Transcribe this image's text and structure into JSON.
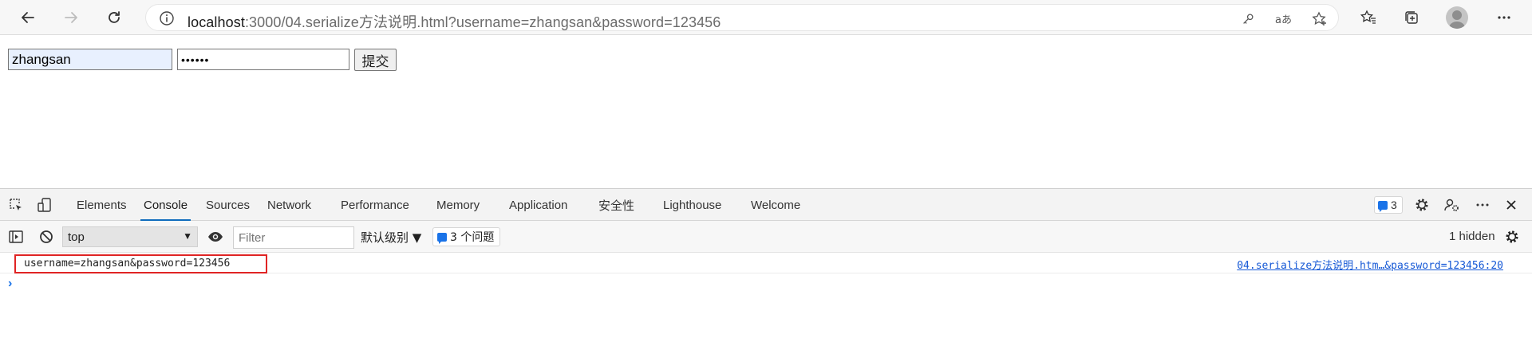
{
  "browser": {
    "url_host": "localhost",
    "url_rest": ":3000/04.serialize方法说明.html?username=zhangsan&password=123456"
  },
  "page": {
    "username_value": "zhangsan",
    "password_value": "••••••",
    "submit_label": "提交"
  },
  "devtools": {
    "tabs": [
      {
        "label": "Elements"
      },
      {
        "label": "Console"
      },
      {
        "label": "Sources"
      },
      {
        "label": "Network"
      },
      {
        "label": "Performance"
      },
      {
        "label": "Memory"
      },
      {
        "label": "Application"
      },
      {
        "label": "安全性"
      },
      {
        "label": "Lighthouse"
      },
      {
        "label": "Welcome"
      }
    ],
    "active_tab": "Console",
    "issues_count": "3",
    "console": {
      "context": "top",
      "filter_placeholder": "Filter",
      "level_label": "默认级别 ▼",
      "issues_label": "3 个问题",
      "hidden_label": "1 hidden",
      "log_message": "username=zhangsan&password=123456",
      "log_source": "04.serialize方法说明.htm…&password=123456:20",
      "prompt": "›"
    }
  },
  "colors": {
    "accent": "#0f6cbd",
    "highlight_border": "#e02424",
    "link": "#1558d6"
  }
}
